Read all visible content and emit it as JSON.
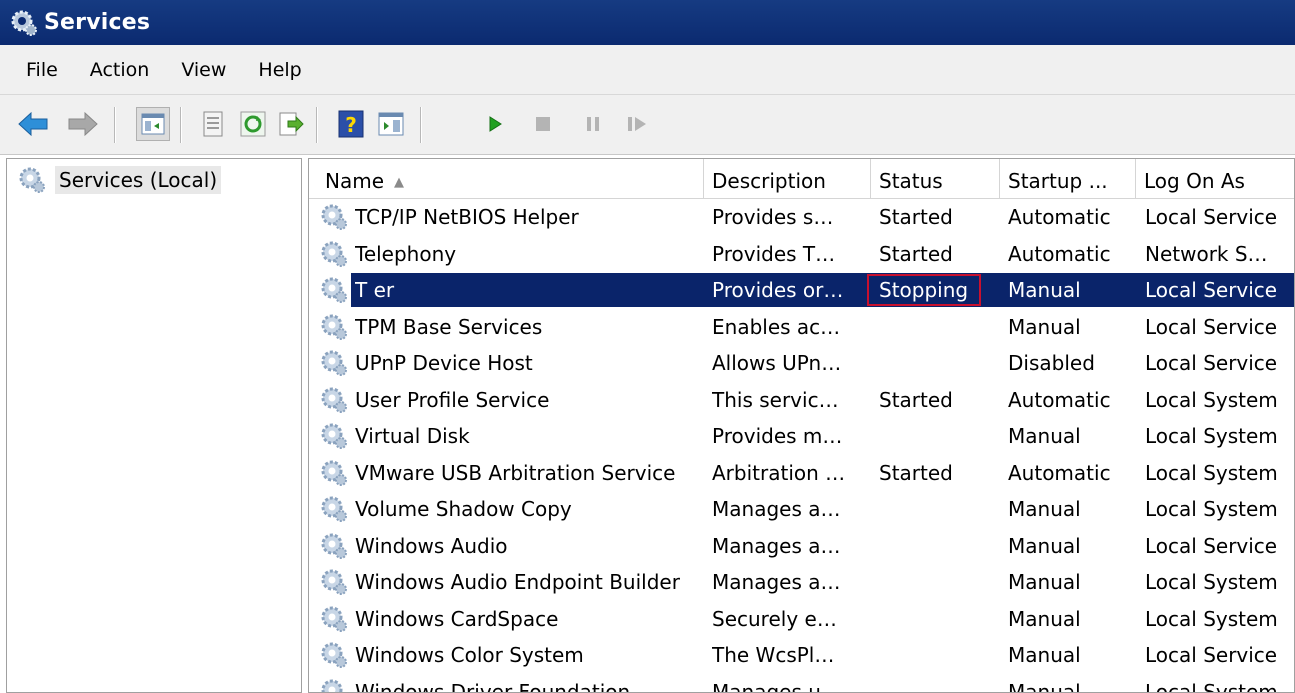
{
  "window": {
    "title": "Services"
  },
  "menu": [
    "File",
    "Action",
    "View",
    "Help"
  ],
  "toolbar": {
    "buttons": [
      "back-arrow-icon",
      "forward-arrow-icon",
      "show-hide-tree-icon",
      "properties-icon",
      "refresh-icon",
      "export-list-icon",
      "help-icon",
      "show-action-pane-icon",
      "start-service-icon",
      "stop-service-icon",
      "pause-service-icon",
      "resume-service-icon"
    ]
  },
  "tree": {
    "root_label": "Services (Local)"
  },
  "table": {
    "columns": [
      "Name",
      "Description",
      "Status",
      "Startup ...",
      "Log On As"
    ],
    "sort_indicator": "▲",
    "rows": [
      {
        "name": "TCP/IP NetBIOS Helper",
        "description": "Provides s…",
        "status": "Started",
        "startup": "Automatic",
        "logon": "Local Service"
      },
      {
        "name": "Telephony",
        "description": "Provides T…",
        "status": "Started",
        "startup": "Automatic",
        "logon": "Network S…"
      },
      {
        "name": "T                    er",
        "description": "Provides or…",
        "status": "Stopping",
        "startup": "Manual",
        "logon": "Local Service",
        "selected": true
      },
      {
        "name": "TPM Base Services",
        "description": "Enables ac…",
        "status": "",
        "startup": "Manual",
        "logon": "Local Service"
      },
      {
        "name": "UPnP Device Host",
        "description": "Allows UPn…",
        "status": "",
        "startup": "Disabled",
        "logon": "Local Service"
      },
      {
        "name": "User Profile Service",
        "description": "This servic…",
        "status": "Started",
        "startup": "Automatic",
        "logon": "Local System"
      },
      {
        "name": "Virtual Disk",
        "description": "Provides m…",
        "status": "",
        "startup": "Manual",
        "logon": "Local System"
      },
      {
        "name": "VMware USB Arbitration Service",
        "description": "Arbitration …",
        "status": "Started",
        "startup": "Automatic",
        "logon": "Local System"
      },
      {
        "name": "Volume Shadow Copy",
        "description": "Manages a…",
        "status": "",
        "startup": "Manual",
        "logon": "Local System"
      },
      {
        "name": "Windows Audio",
        "description": "Manages a…",
        "status": "",
        "startup": "Manual",
        "logon": "Local Service"
      },
      {
        "name": "Windows Audio Endpoint Builder",
        "description": "Manages a…",
        "status": "",
        "startup": "Manual",
        "logon": "Local System"
      },
      {
        "name": "Windows CardSpace",
        "description": "Securely e…",
        "status": "",
        "startup": "Manual",
        "logon": "Local System"
      },
      {
        "name": "Windows Color System",
        "description": "The WcsPl…",
        "status": "",
        "startup": "Manual",
        "logon": "Local Service"
      },
      {
        "name": "Windows Driver Foundation",
        "description": "Manages u…",
        "status": "",
        "startup": "Manual",
        "logon": "Local System"
      }
    ]
  },
  "colors": {
    "titlebar": "#0b2a70",
    "selection": "#0a246a",
    "highlight_box": "#c8102e"
  }
}
